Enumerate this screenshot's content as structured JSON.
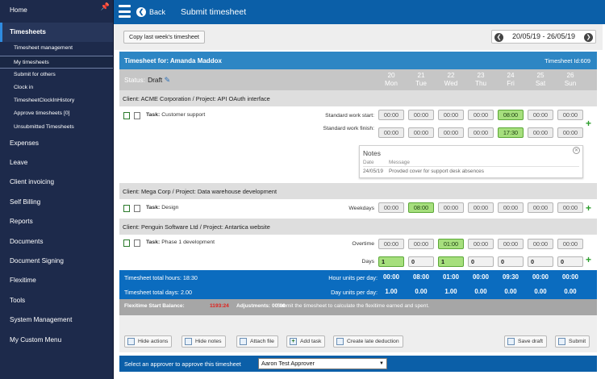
{
  "sidebar": {
    "items": [
      {
        "label": "Home"
      },
      {
        "label": "Timesheets"
      },
      {
        "label": "Expenses"
      },
      {
        "label": "Leave"
      },
      {
        "label": "Client invoicing"
      },
      {
        "label": "Self Billing"
      },
      {
        "label": "Reports"
      },
      {
        "label": "Documents"
      },
      {
        "label": "Document Signing"
      },
      {
        "label": "Flexitime"
      },
      {
        "label": "Tools"
      },
      {
        "label": "System Management"
      },
      {
        "label": "My Custom Menu"
      }
    ],
    "subitems": [
      {
        "label": "Timesheet management"
      },
      {
        "label": "My timesheets"
      },
      {
        "label": "Submit for others"
      },
      {
        "label": "Clock in"
      },
      {
        "label": "TimesheetClockInHistory"
      },
      {
        "label": "Approve timesheets [0]"
      },
      {
        "label": "Unsubmitted Timesheets"
      }
    ]
  },
  "header": {
    "back_label": "Back",
    "title": "Submit timesheet"
  },
  "toolbar": {
    "copy_label": "Copy last week's timesheet",
    "date_range": "20/05/19 - 26/05/19"
  },
  "timesheet": {
    "for_label": "Timesheet for: Amanda Maddox",
    "id_label": "Timesheet Id:609",
    "status_label": "Status:",
    "status_value": "Draft",
    "days": [
      {
        "num": "20",
        "name": "Mon"
      },
      {
        "num": "21",
        "name": "Tue"
      },
      {
        "num": "22",
        "name": "Wed"
      },
      {
        "num": "23",
        "name": "Thu"
      },
      {
        "num": "24",
        "name": "Fri"
      },
      {
        "num": "25",
        "name": "Sat"
      },
      {
        "num": "26",
        "name": "Sun"
      }
    ]
  },
  "clients": [
    {
      "title": "Client: ACME Corporation / Project: API OAuth interface",
      "task_label": "Task:",
      "task_name": "Customer support",
      "rows": [
        {
          "label": "Standard work start:",
          "values": [
            "00:00",
            "00:00",
            "00:00",
            "00:00",
            "08:00",
            "00:00",
            "00:00"
          ]
        },
        {
          "label": "Standard work finish:",
          "values": [
            "00:00",
            "00:00",
            "00:00",
            "00:00",
            "17:30",
            "00:00",
            "00:00"
          ]
        }
      ]
    },
    {
      "title": "Client: Mega Corp / Project: Data warehouse development",
      "task_label": "Task:",
      "task_name": "Design",
      "rows": [
        {
          "label": "Weekdays",
          "values": [
            "00:00",
            "08:00",
            "00:00",
            "00:00",
            "00:00",
            "00:00",
            "00:00"
          ]
        }
      ]
    },
    {
      "title": "Client: Penguin Software Ltd / Project: Antartica website",
      "task_label": "Task:",
      "task_name": "Phase 1 development",
      "rows": [
        {
          "label": "Overtime",
          "values": [
            "00:00",
            "00:00",
            "01:00",
            "00:00",
            "00:00",
            "00:00",
            "00:00"
          ]
        },
        {
          "label": "Days",
          "values": [
            "1",
            "0",
            "1",
            "0",
            "0",
            "0",
            "0"
          ]
        }
      ]
    }
  ],
  "notes": {
    "title": "Notes",
    "col_date": "Date",
    "col_message": "Message",
    "date": "24/05/19",
    "message": "Provded cover for support desk absences"
  },
  "totals": {
    "total_hours": "Timesheet total hours: 18:30",
    "total_days": "Timesheet total days: 2.00",
    "hour_units_label": "Hour units per day:",
    "day_units_label": "Day units per day:",
    "hour_units": [
      "00:00",
      "08:00",
      "01:00",
      "00:00",
      "09:30",
      "00:00",
      "00:00"
    ],
    "day_units": [
      "1.00",
      "0.00",
      "1.00",
      "0.00",
      "0.00",
      "0.00",
      "0.00"
    ]
  },
  "flexi": {
    "balance_label": "Flexitime Start Balance:",
    "balance_value": "1193:24",
    "adjustments": "Adjustments: 00:00",
    "message": "Submit the timesheet to calculate the flexitime earned and spent."
  },
  "actions": {
    "hide_actions": "Hide actions",
    "hide_notes": "Hide notes",
    "attach_file": "Attach file",
    "add_task": "Add task",
    "late_deduction": "Create late deduction",
    "save_draft": "Save draft",
    "submit": "Submit"
  },
  "approver": {
    "label": "Select an approver to approve this timesheet",
    "selected": "Aaron Test Approver"
  },
  "colors": {
    "sidebar": "#1d2a4b",
    "header": "#0b5fa8",
    "accent": "#2d86c4",
    "green": "#a6df7d",
    "flexi_red": "#e0201b"
  }
}
